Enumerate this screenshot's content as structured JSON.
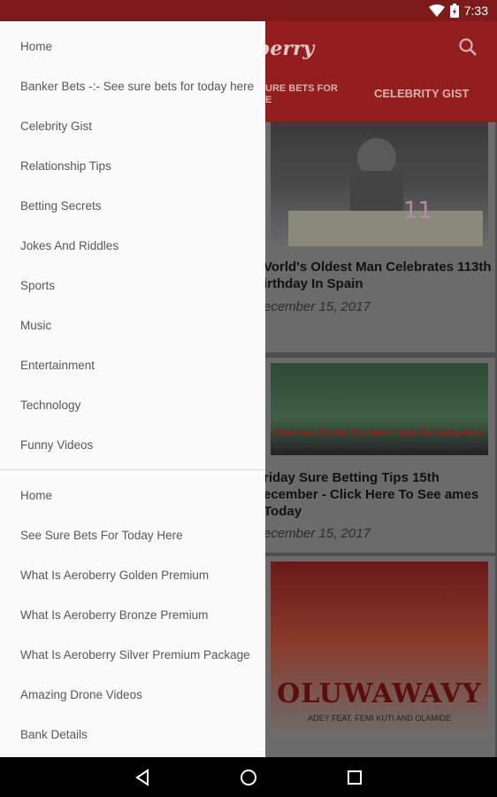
{
  "status_bar": {
    "time": "7:33"
  },
  "app": {
    "logo_fragment": "berry",
    "tabs": [
      "URE BETS FOR E",
      "CELEBRITY GIST"
    ],
    "cards": [
      {
        "title": "World's Oldest Man Celebrates 113th Birthday In Spain",
        "title_visible": "Vorld's Oldest Man Celebrates 113th irthday In Spain",
        "date": "ecember 15, 2017"
      },
      {
        "title_visible": "riday Sure Betting Tips 15th ecember - Click Here To See ames Today",
        "date": "ecember 15, 2017",
        "overlay_line1": "Click Here To See The Surest Bets For Today Now.",
        "overlay_line2": "Click Here To See The Surest Bets For Today Now"
      },
      {
        "art_title": "OLUWAWAVY",
        "art_sub": "ADEY FEAT. FEMI KUTI AND OLAMIDE"
      }
    ]
  },
  "drawer": {
    "group1": [
      "Home",
      "Banker Bets -:- See sure bets for today here",
      "Celebrity Gist",
      "Relationship Tips",
      "Betting Secrets",
      "Jokes And Riddles",
      "Sports",
      "Music",
      "Entertainment",
      "Technology",
      "Funny Videos"
    ],
    "group2": [
      "Home",
      "See Sure Bets For Today Here",
      "What Is Aeroberry Golden Premium",
      "What Is Aeroberry Bronze Premium",
      "What Is Aeroberry Silver Premium Package",
      "Amazing Drone Videos",
      "Bank Details"
    ]
  },
  "colors": {
    "status_bar": "#7f1a1a",
    "toolbar": "#931e1e",
    "drawer_bg": "#fafafa"
  }
}
